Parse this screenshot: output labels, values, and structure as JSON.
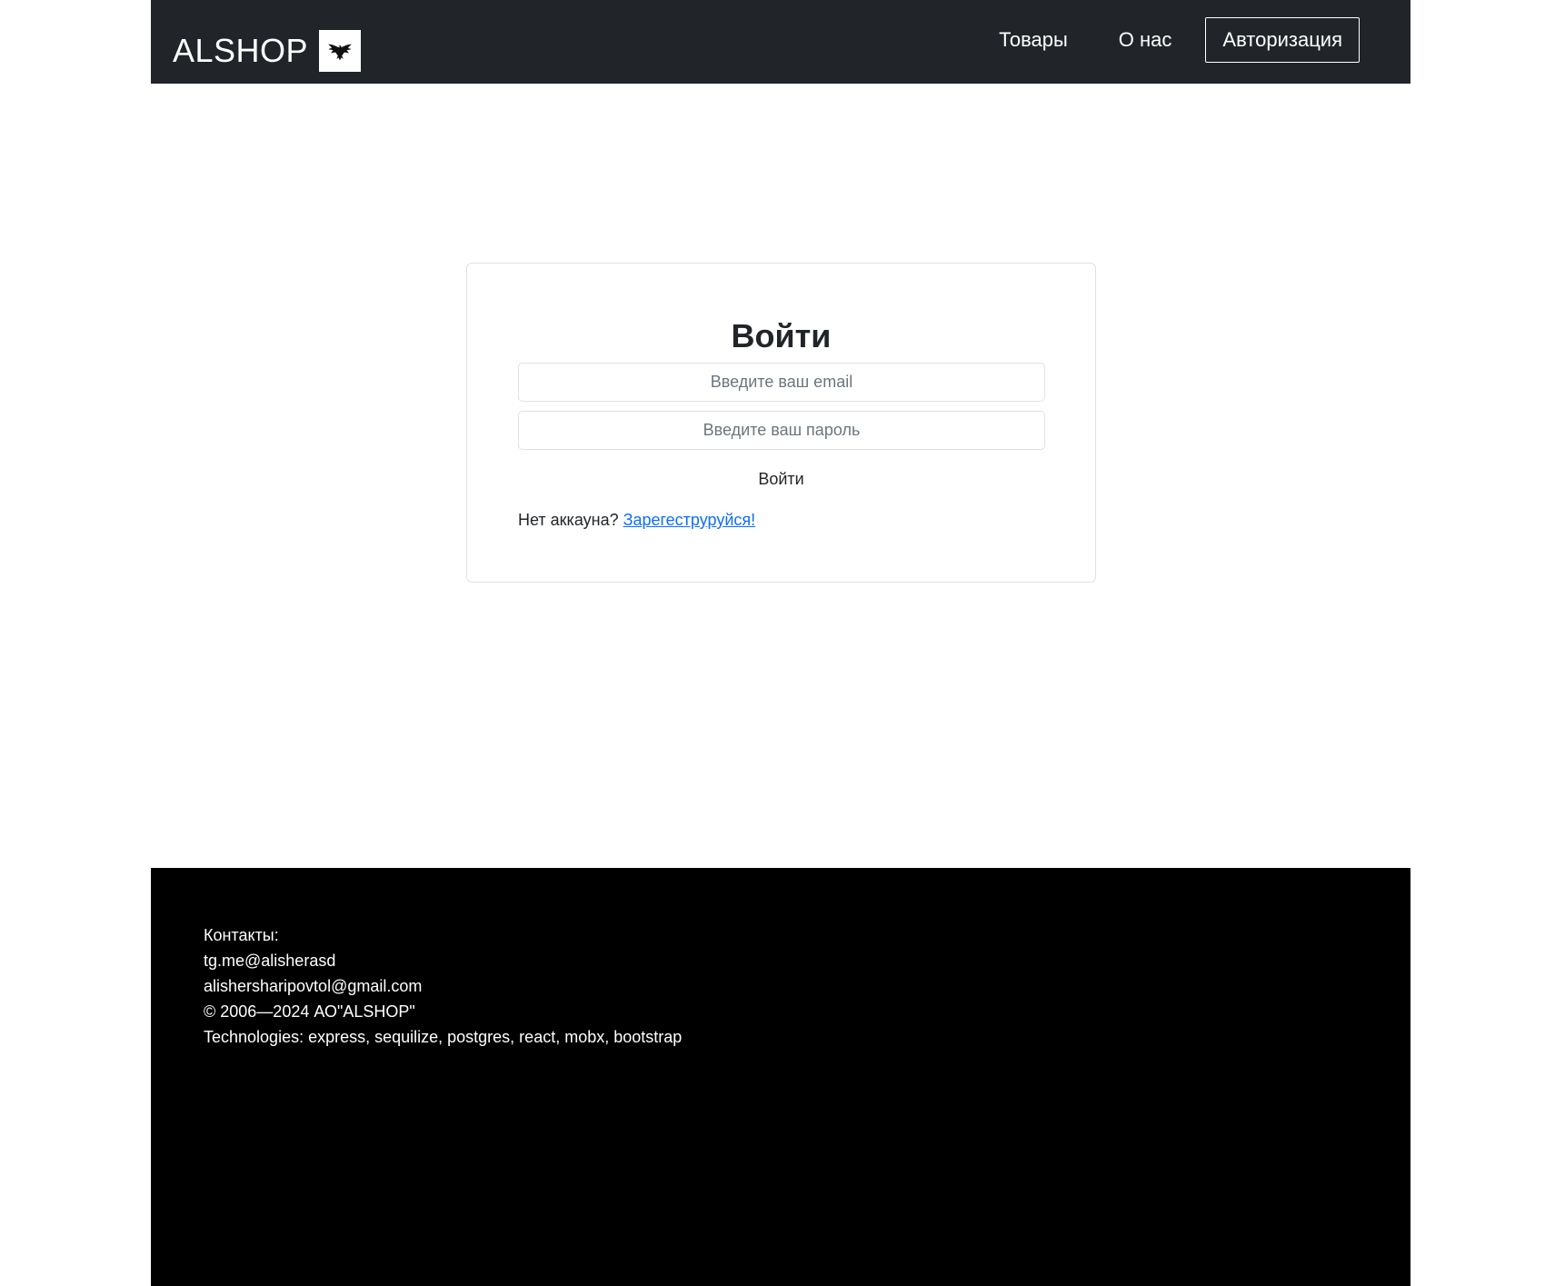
{
  "header": {
    "brand": "ALSHOP",
    "logo_icon": "eagle-icon",
    "nav": {
      "products": "Товары",
      "about": "О нас",
      "auth": "Авторизация"
    }
  },
  "login": {
    "title": "Войти",
    "email_placeholder": "Введите ваш email",
    "password_placeholder": "Введите ваш пароль",
    "email_value": "",
    "password_value": "",
    "submit_label": "Войти",
    "no_account_text": "Нет аккауна?",
    "register_link": "Зарегеструруйся!"
  },
  "footer": {
    "contacts_label": "Контакты:",
    "telegram": "tg.me@alisherasd",
    "email": "alishersharipovtol@gmail.com",
    "copyright": "© 2006—2024 АО\"ALSHOP\"",
    "technologies": "Technologies: express, sequilize, postgres, react, mobx, bootstrap"
  },
  "colors": {
    "navbar_bg": "#212529",
    "footer_bg": "#000000",
    "link": "#0d6efd"
  }
}
